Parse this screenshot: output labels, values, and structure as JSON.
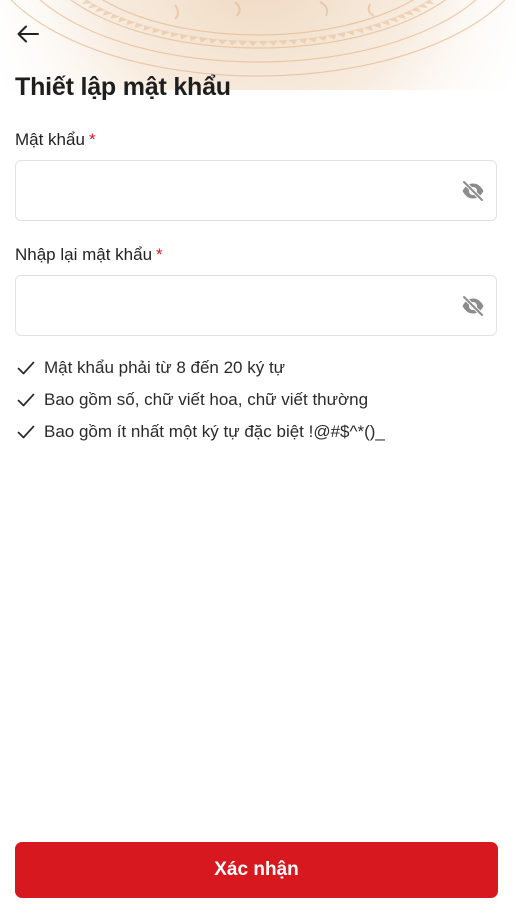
{
  "page": {
    "title": "Thiết lập mật khẩu"
  },
  "password_field": {
    "label": "Mật khẩu",
    "required_mark": "*",
    "value": "",
    "placeholder": ""
  },
  "confirm_password_field": {
    "label": "Nhập lại mật khẩu",
    "required_mark": "*",
    "value": "",
    "placeholder": ""
  },
  "rules": [
    {
      "text": "Mật khẩu phải từ 8 đến 20 ký tự",
      "icon": "check-icon"
    },
    {
      "text": "Bao gồm số, chữ viết hoa, chữ viết thường",
      "icon": "check-icon"
    },
    {
      "text": "Bao gồm ít nhất một ký tự đặc biệt !@#$^*()_",
      "icon": "check-icon"
    }
  ],
  "confirm_button": {
    "label": "Xác nhận"
  },
  "icons": {
    "back": "arrow-left-icon",
    "visibility_toggle": "eye-off-icon"
  },
  "colors": {
    "primary": "#d7191f",
    "required": "#d7191f",
    "pattern": "#e9c9a7",
    "text": "#1f1f1f",
    "border": "#e2e2e2"
  }
}
